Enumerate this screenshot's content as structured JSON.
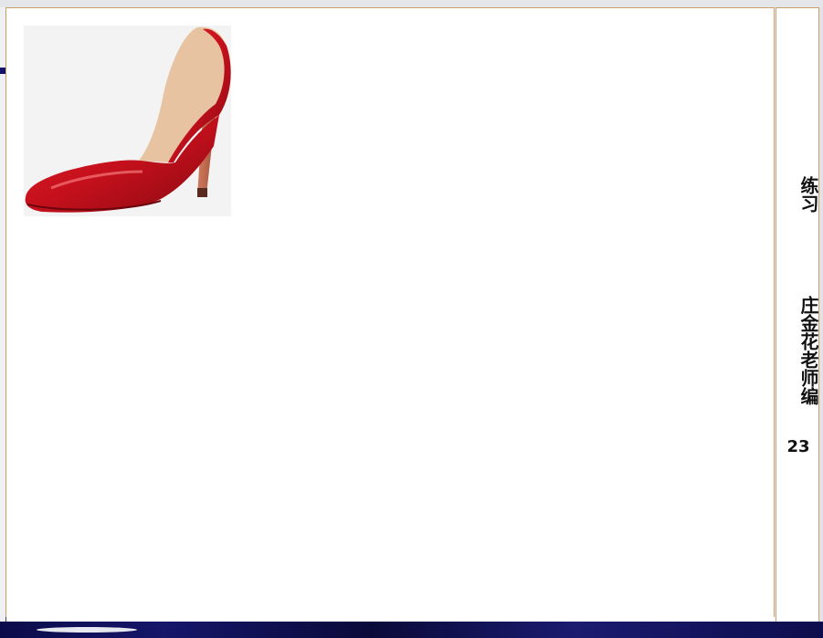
{
  "slide": {
    "image_name": "red-high-heel-shoe",
    "colors": {
      "shoe_red": "#c4101c",
      "shoe_dark": "#8a0a12",
      "shoe_lining": "#e8c3a2",
      "heel": "#b8624a",
      "frame_border": "#c9a06a"
    }
  },
  "side_panel": {
    "title": "练习",
    "author": "庄金花老师编",
    "page_number": "23"
  }
}
